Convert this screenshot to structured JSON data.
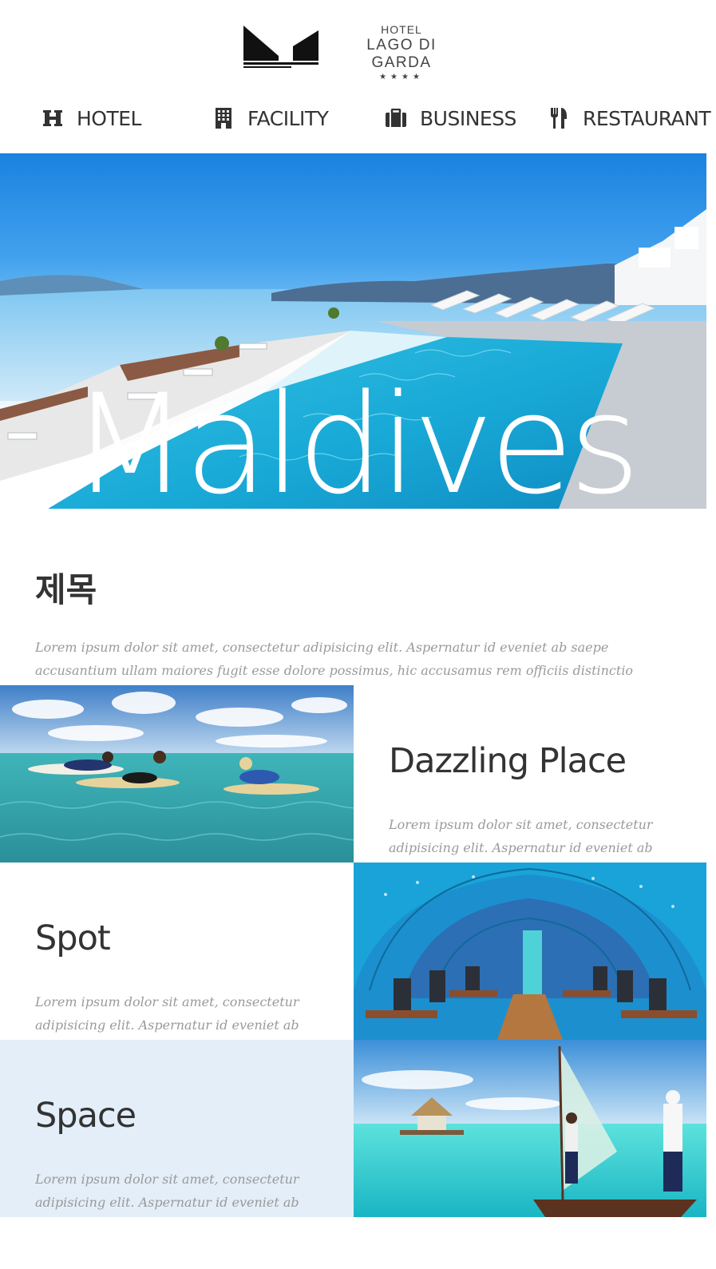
{
  "logo": {
    "hotel": "HOTEL",
    "name": "LAGO DI GARDA",
    "stars": "★★★★"
  },
  "nav": [
    {
      "label": "HOTEL",
      "icon": "h-icon"
    },
    {
      "label": "FACILITY",
      "icon": "building-icon"
    },
    {
      "label": "BUSINESS",
      "icon": "briefcase-icon"
    },
    {
      "label": "RESTAURANT",
      "icon": "cutlery-icon"
    }
  ],
  "hero": {
    "title": "Maldives"
  },
  "intro": {
    "title": "제목",
    "text": "Lorem ipsum dolor sit amet, consectetur adipisicing elit. Aspernatur id eveniet ab saepe accusantium ullam maiores fugit esse dolore possimus, hic accusamus rem officiis distinctio laudantium. Enim possimus, iusto"
  },
  "features": [
    {
      "title": "Dazzling Place",
      "text": "Lorem ipsum dolor sit amet, consectetur adipisicing elit. Aspernatur id eveniet ab saepe"
    },
    {
      "title": "Spot",
      "text": "Lorem ipsum dolor sit amet, consectetur adipisicing elit. Aspernatur id eveniet ab saepe"
    },
    {
      "title": "Space",
      "text": "Lorem ipsum dolor sit amet, consectetur adipisicing elit. Aspernatur id eveniet ab saepe"
    }
  ],
  "colors": {
    "text": "#333333",
    "muted": "#9a9a9a",
    "band": "#e3eef8",
    "sea": "#2fb8d8"
  }
}
